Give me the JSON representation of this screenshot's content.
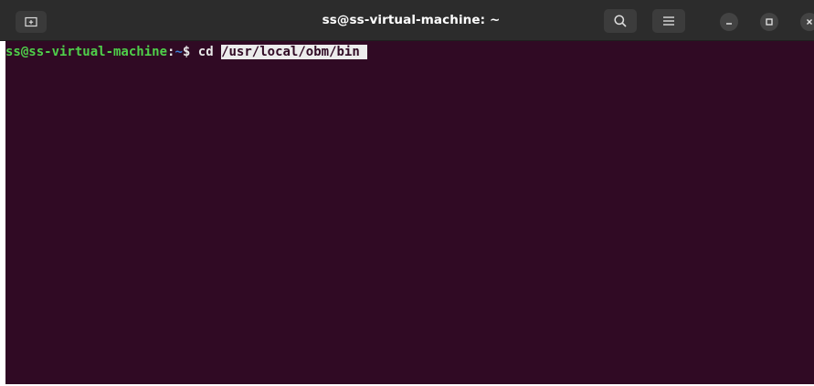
{
  "window": {
    "title": "ss@ss-virtual-machine: ~"
  },
  "header_buttons": {
    "new_tab_icon": "new-tab-icon",
    "search_icon": "search-icon",
    "menu_icon": "hamburger-menu-icon",
    "minimize_icon": "minimize-icon",
    "maximize_icon": "maximize-icon",
    "close_icon": "close-icon"
  },
  "terminal": {
    "background": "#300a24",
    "prompt": {
      "user_host": "ss@ss-virtual-machine",
      "colon": ":",
      "path": "~",
      "symbol": "$",
      "user_color": "#4fcf4a",
      "path_color": "#3d7fd8"
    },
    "command": "cd ",
    "selected_text": "/usr/local/obm/bin "
  }
}
